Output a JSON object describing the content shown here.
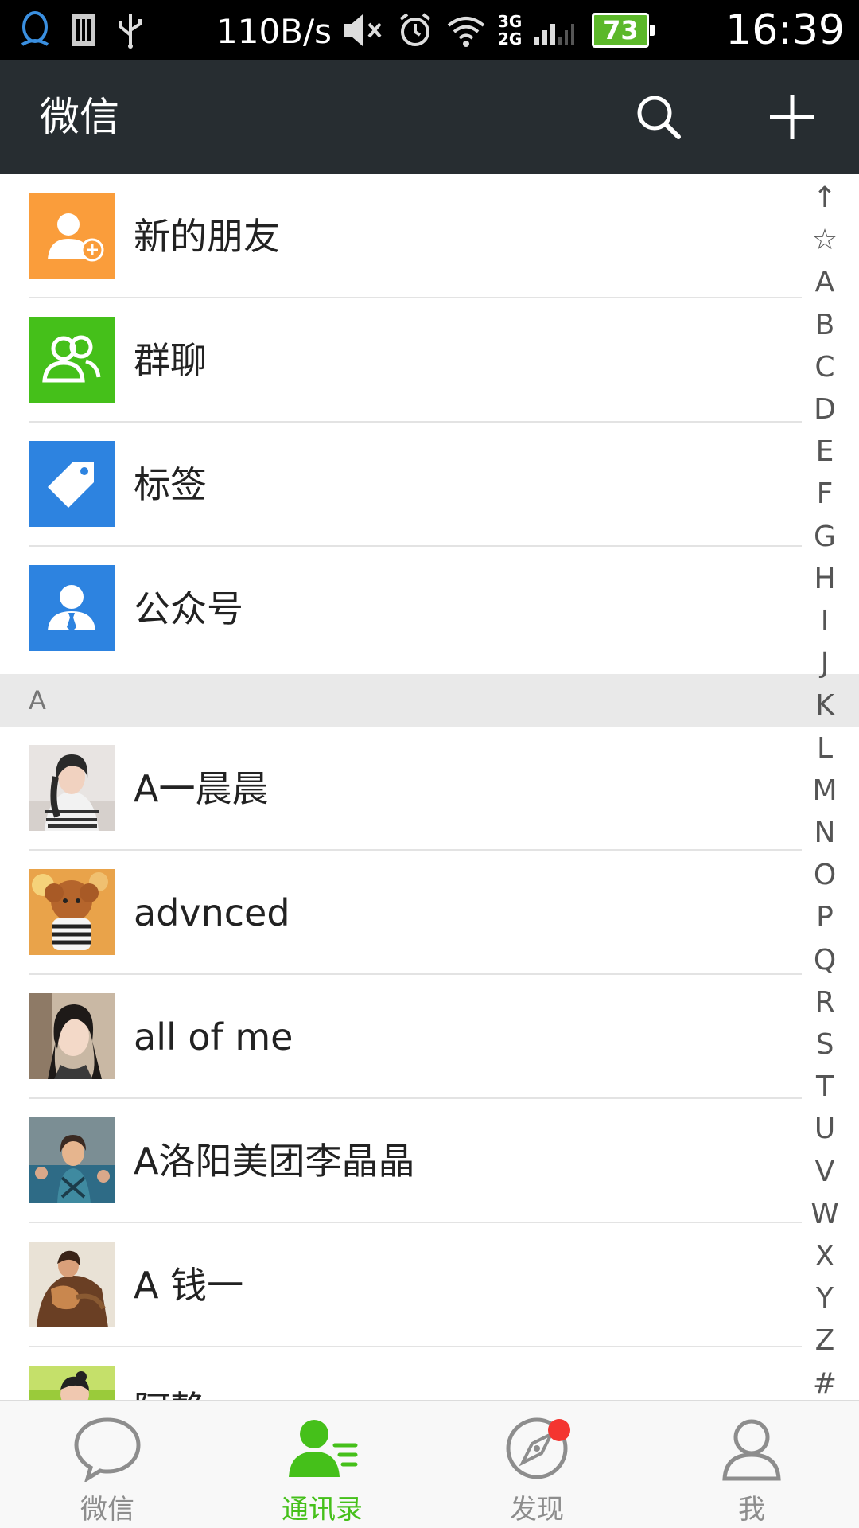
{
  "status_bar": {
    "net_speed": "110B/s",
    "net_types": [
      "3G",
      "2G"
    ],
    "battery": "73",
    "time": "16:39",
    "icons": [
      "qq-icon",
      "sim-icon",
      "usb-icon",
      "mute-icon",
      "alarm-icon",
      "wifi-icon",
      "signal-icon",
      "battery-icon"
    ]
  },
  "header": {
    "title": "微信",
    "search_icon": "search-icon",
    "add_icon": "plus-icon"
  },
  "fixed_items": [
    {
      "label": "新的朋友",
      "icon": "add-friend-icon",
      "color": "#fa9d3b"
    },
    {
      "label": "群聊",
      "icon": "group-chat-icon",
      "color": "#45c01a"
    },
    {
      "label": "标签",
      "icon": "tag-icon",
      "color": "#2d83e0"
    },
    {
      "label": "公众号",
      "icon": "official-account-icon",
      "color": "#2d83e0"
    }
  ],
  "section_letter": "A",
  "contacts": [
    {
      "name": "A一晨晨"
    },
    {
      "name": "advnced"
    },
    {
      "name": "all of me"
    },
    {
      "name": "A洛阳美团李晶晶"
    },
    {
      "name": "A 钱一"
    },
    {
      "name": "阿静"
    }
  ],
  "index_letters": [
    "↑",
    "☆",
    "A",
    "B",
    "C",
    "D",
    "E",
    "F",
    "G",
    "H",
    "I",
    "J",
    "K",
    "L",
    "M",
    "N",
    "O",
    "P",
    "Q",
    "R",
    "S",
    "T",
    "U",
    "V",
    "W",
    "X",
    "Y",
    "Z",
    "#"
  ],
  "tabs": [
    {
      "label": "微信",
      "icon": "chat-bubble-icon",
      "active": false
    },
    {
      "label": "通讯录",
      "icon": "contacts-icon",
      "active": true
    },
    {
      "label": "发现",
      "icon": "compass-icon",
      "active": false,
      "badge": true
    },
    {
      "label": "我",
      "icon": "profile-icon",
      "active": false
    }
  ],
  "colors": {
    "accent": "#45c01a",
    "titlebar": "#272d31",
    "badge": "#f43530"
  }
}
